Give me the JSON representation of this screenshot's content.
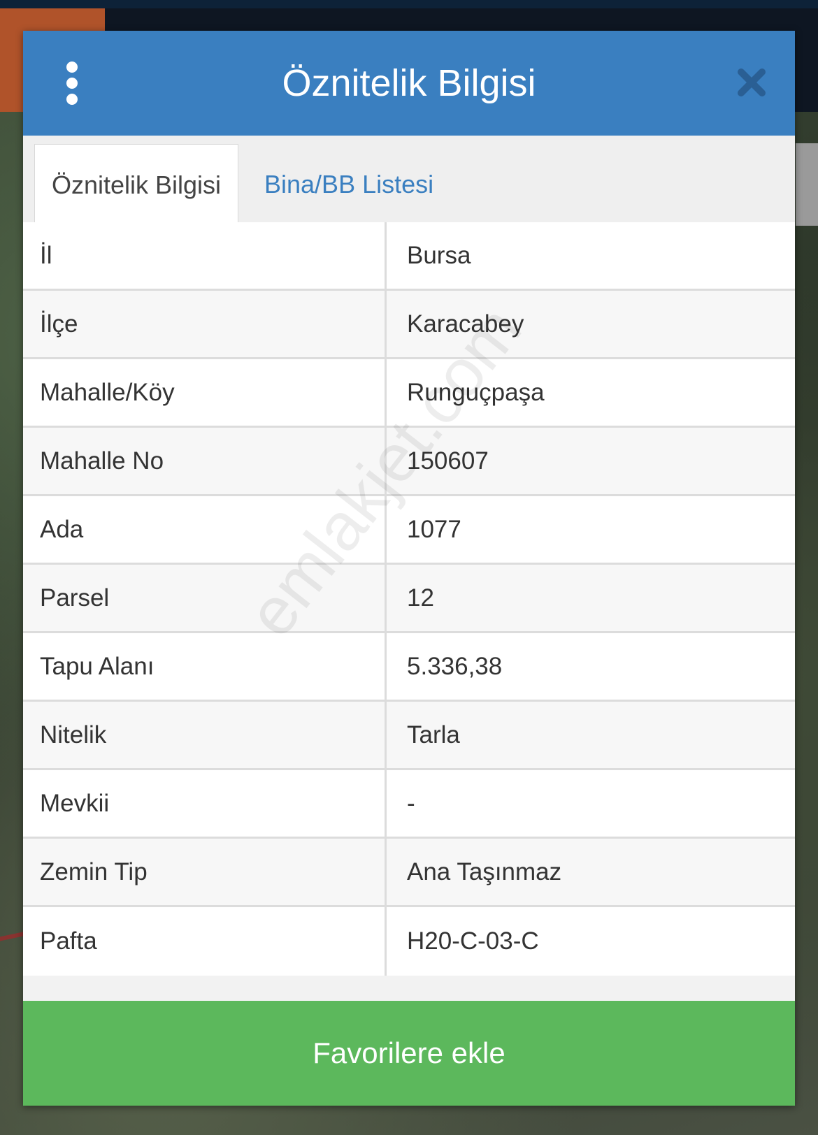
{
  "header": {
    "title": "Öznitelik Bilgisi"
  },
  "tabs": [
    {
      "label": "Öznitelik Bilgisi",
      "active": true
    },
    {
      "label": "Bina/BB Listesi",
      "active": false
    }
  ],
  "rows": [
    {
      "label": "İl",
      "value": "Bursa"
    },
    {
      "label": "İlçe",
      "value": "Karacabey"
    },
    {
      "label": "Mahalle/Köy",
      "value": "Runguçpaşa"
    },
    {
      "label": "Mahalle No",
      "value": "150607"
    },
    {
      "label": "Ada",
      "value": "1077"
    },
    {
      "label": "Parsel",
      "value": "12"
    },
    {
      "label": "Tapu Alanı",
      "value": "5.336,38"
    },
    {
      "label": "Nitelik",
      "value": "Tarla"
    },
    {
      "label": "Mevkii",
      "value": "-"
    },
    {
      "label": "Zemin Tip",
      "value": "Ana Taşınmaz"
    },
    {
      "label": "Pafta",
      "value": "H20-C-03-C"
    }
  ],
  "watermark": "emlakjet.com",
  "footer": {
    "favorite_label": "Favorilere ekle"
  },
  "colors": {
    "header": "#3a7fc0",
    "tab_link": "#3a7fc0",
    "favorite_button": "#5cb85c"
  },
  "icons": {
    "menu": "vertical-dots-icon",
    "close": "close-icon"
  }
}
